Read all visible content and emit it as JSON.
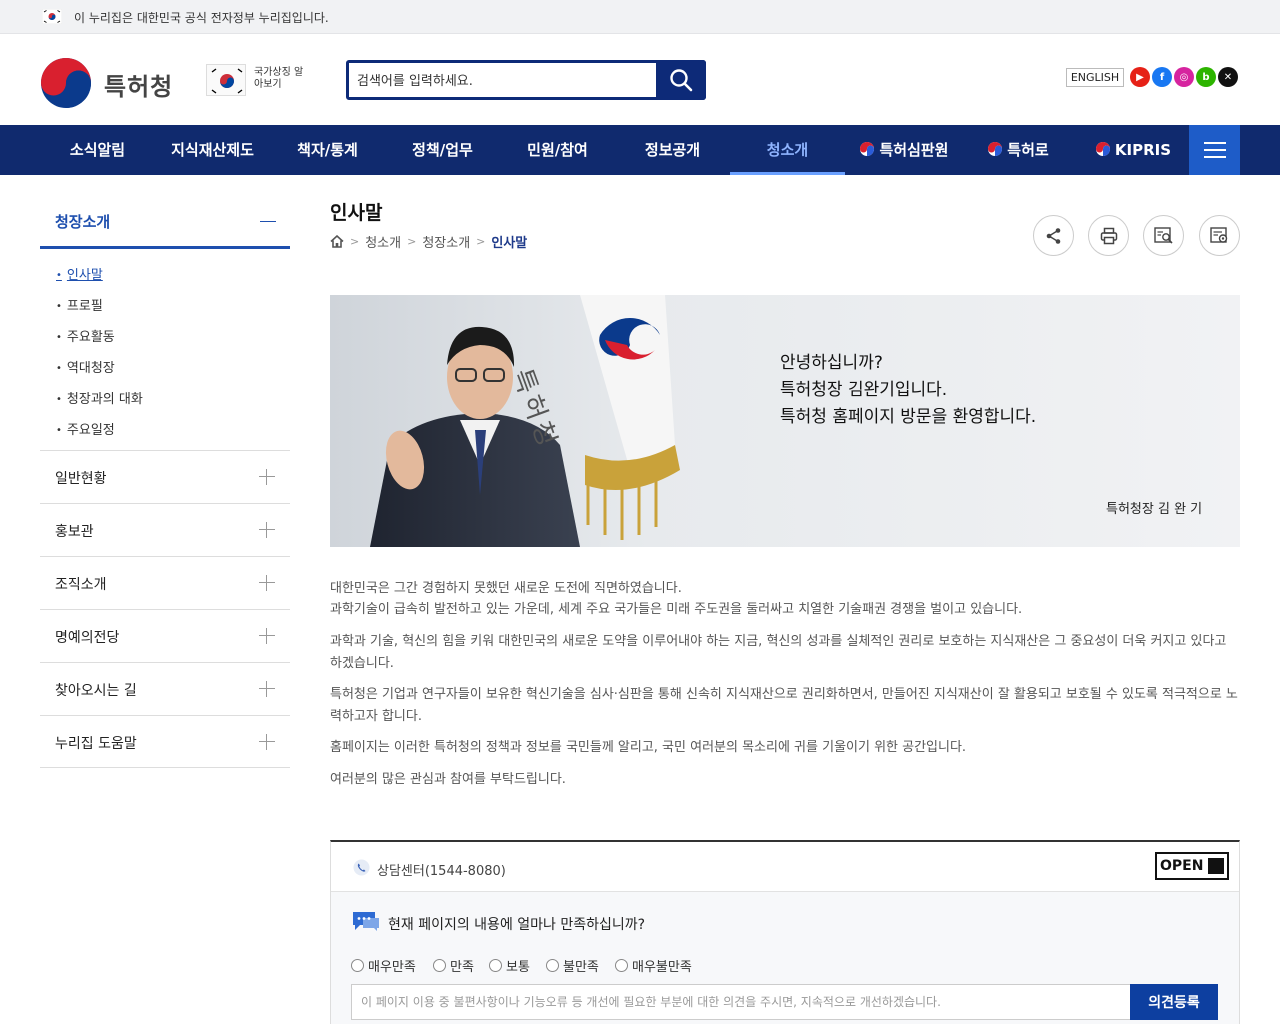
{
  "gov_banner": {
    "text": "이 누리집은 대한민국 공식 전자정부 누리집입니다."
  },
  "header": {
    "logo_text": "특허청",
    "national_symbol_label": "국가상징 알아보기",
    "search_placeholder": "검색어를 입력하세요.",
    "language_button": "ENGLISH",
    "sns": [
      {
        "name": "youtube-icon",
        "color": "#e62117",
        "glyph": "▶"
      },
      {
        "name": "facebook-icon",
        "color": "#1877f2",
        "glyph": "f"
      },
      {
        "name": "instagram-icon",
        "color": "#d6249f",
        "glyph": "◎"
      },
      {
        "name": "blog-icon",
        "color": "#2db400",
        "glyph": "b"
      },
      {
        "name": "x-icon",
        "color": "#111111",
        "glyph": "✕"
      }
    ]
  },
  "gnb": {
    "items": [
      "소식알림",
      "지식재산제도",
      "책자/통계",
      "정책/업무",
      "민원/참여",
      "정보공개",
      "청소개",
      "특허심판원",
      "특허로",
      "KIPRIS"
    ],
    "active": "청소개"
  },
  "sidebar": {
    "title": "청장소개",
    "sub_items": [
      "인사말",
      "프로필",
      "주요활동",
      "역대청장",
      "청장과의 대화",
      "주요일정"
    ],
    "active_sub": "인사말",
    "groups": [
      "일반현황",
      "홍보관",
      "조직소개",
      "명예의전당",
      "찾아오시는 길",
      "누리집 도움말"
    ]
  },
  "content": {
    "title": "인사말",
    "breadcrumb": [
      "청소개",
      "청장소개",
      "인사말"
    ],
    "banner": {
      "lines": [
        "안녕하십니까?",
        "특허청장 김완기입니다.",
        "특허청 홈페이지 방문을 환영합니다."
      ],
      "flag_text": "특허청",
      "signature": "특허청장 김 완 기"
    },
    "paragraphs": [
      "대한민국은 그간 경험하지 못했던 새로운 도전에 직면하였습니다.",
      "과학기술이 급속히 발전하고 있는 가운데, 세계 주요 국가들은 미래 주도권을 둘러싸고 치열한 기술패권 경쟁을 벌이고 있습니다.",
      "과학과 기술, 혁신의 힘을 키워 대한민국의 새로운 도약을 이루어내야 하는 지금, 혁신의 성과를 실체적인 권리로 보호하는 지식재산은 그 중요성이 더욱 커지고 있다고 하겠습니다.",
      "특허청은 기업과 연구자들이 보유한 혁신기술을 심사·심판을 통해 신속히 지식재산으로 권리화하면서, 만들어진 지식재산이 잘 활용되고 보호될 수 있도록 적극적으로 노력하고자 합니다.",
      "홈페이지는 이러한 특허청의 정책과 정보를 국민들께 알리고, 국민 여러분의 목소리에 귀를 기울이기 위한 공간입니다.",
      "여러분의 많은 관심과 참여를 부탁드립니다."
    ]
  },
  "feedback": {
    "center": "상담센터(1544-8080)",
    "open_badge": "OPEN",
    "question": "현재 페이지의 내용에 얼마나 만족하십니까?",
    "options": [
      "매우만족",
      "만족",
      "보통",
      "불만족",
      "매우불만족"
    ],
    "input_placeholder": "이 페이지 이용 중 불편사항이나 기능오류 등 개선에 필요한 부분에 대한 의견을 주시면, 지속적으로 개선하겠습니다.",
    "submit": "의견등록"
  }
}
